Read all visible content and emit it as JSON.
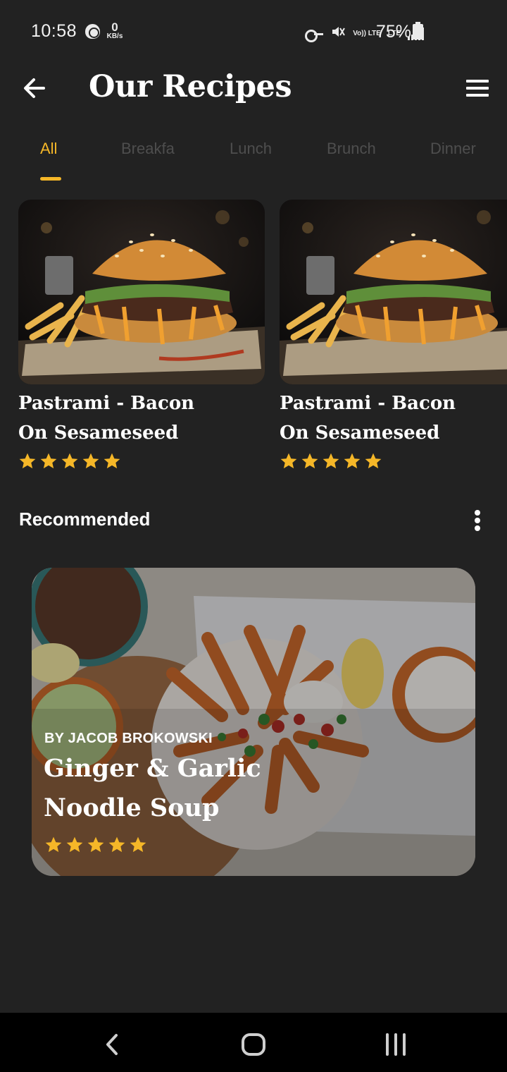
{
  "status_bar": {
    "time": "10:58",
    "speed_value": "0",
    "speed_unit": "KB/s",
    "net_top": "Vo)) LTE",
    "net_mid": "LTE",
    "battery": "75%",
    "icons": [
      "vpn-icon",
      "key-icon",
      "mute-icon",
      "signal-icon",
      "battery-icon"
    ]
  },
  "header": {
    "title": "Our Recipes",
    "back_icon": "arrow-left-icon",
    "menu_icon": "hamburger-icon"
  },
  "tabs": [
    {
      "label": "All",
      "active": true
    },
    {
      "label": "Breakfa",
      "active": false
    },
    {
      "label": "Lunch",
      "active": false
    },
    {
      "label": "Brunch",
      "active": false
    },
    {
      "label": "Dinner",
      "active": false
    }
  ],
  "featured": [
    {
      "title_line1": "Pastrami - Bacon",
      "title_line2": "On Sesameseed",
      "rating": 5
    },
    {
      "title_line1": "Pastrami - Bacon",
      "title_line2": "On Sesameseed",
      "rating": 5
    }
  ],
  "recommended": {
    "heading": "Recommended",
    "more_icon": "more-vertical-icon",
    "card": {
      "author": "BY JACOB BROKOWSKI",
      "title": "Ginger & Garlic Noodle Soup",
      "rating": 5
    }
  },
  "colors": {
    "accent": "#f5b728",
    "background": "#222222",
    "inactive_tab": "#4e4e4e"
  },
  "nav_bar": [
    "back-nav-icon",
    "home-nav-icon",
    "recents-nav-icon"
  ]
}
